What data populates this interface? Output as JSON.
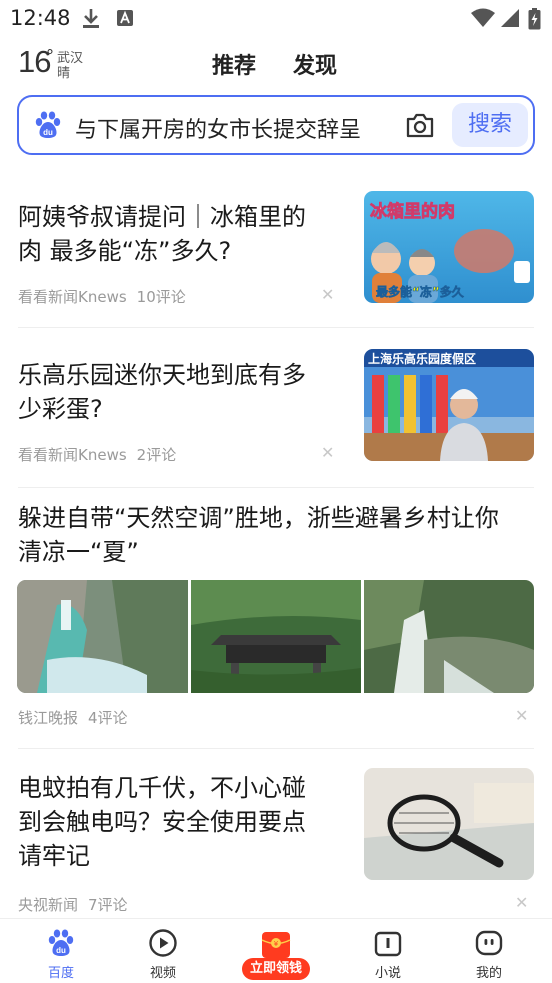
{
  "status_bar": {
    "time": "12:48"
  },
  "weather": {
    "temp": "16",
    "degree": "°",
    "city": "武汉",
    "condition": "晴"
  },
  "header_tabs": [
    "推荐",
    "发现"
  ],
  "search": {
    "query": "与下属开房的女市长提交辞呈",
    "button": "搜索"
  },
  "articles": [
    {
      "title_lines": [
        "阿姨爷叔请提问｜冰箱里的",
        "肉 最多能“冻”多久?"
      ],
      "source": "看看新闻Knews",
      "comments": "10评论",
      "thumb_text": {
        "banner": "冰箱里的肉",
        "caption": "最多能“冻”多久"
      }
    },
    {
      "title_lines": [
        "乐高乐园迷你天地到底有多",
        "少彩蛋?"
      ],
      "source": "看看新闻Knews",
      "comments": "2评论",
      "thumb_text": {
        "banner": "上海乐高乐园度假区"
      }
    },
    {
      "title_lines": [
        "躲进自带“天然空调”胜地，浙些避暑乡村让你",
        "清凉一“夏”"
      ],
      "source": "钱江晚报",
      "comments": "4评论"
    },
    {
      "title_lines": [
        "电蚊拍有几千伏，不小心碰",
        "到会触电吗？安全使用要点",
        "请牢记"
      ],
      "source": "央视新闻",
      "comments": "7评论"
    }
  ],
  "tabbar": [
    {
      "label": "百度",
      "icon": "baidu-paw-icon"
    },
    {
      "label": "视频",
      "icon": "play-icon"
    },
    {
      "label": "立即领钱",
      "icon": "red-envelope-icon"
    },
    {
      "label": "小说",
      "icon": "book-icon"
    },
    {
      "label": "我的",
      "icon": "profile-icon"
    }
  ],
  "colors": {
    "accent": "#4e6ef2",
    "promo": "#ff3b1f"
  }
}
